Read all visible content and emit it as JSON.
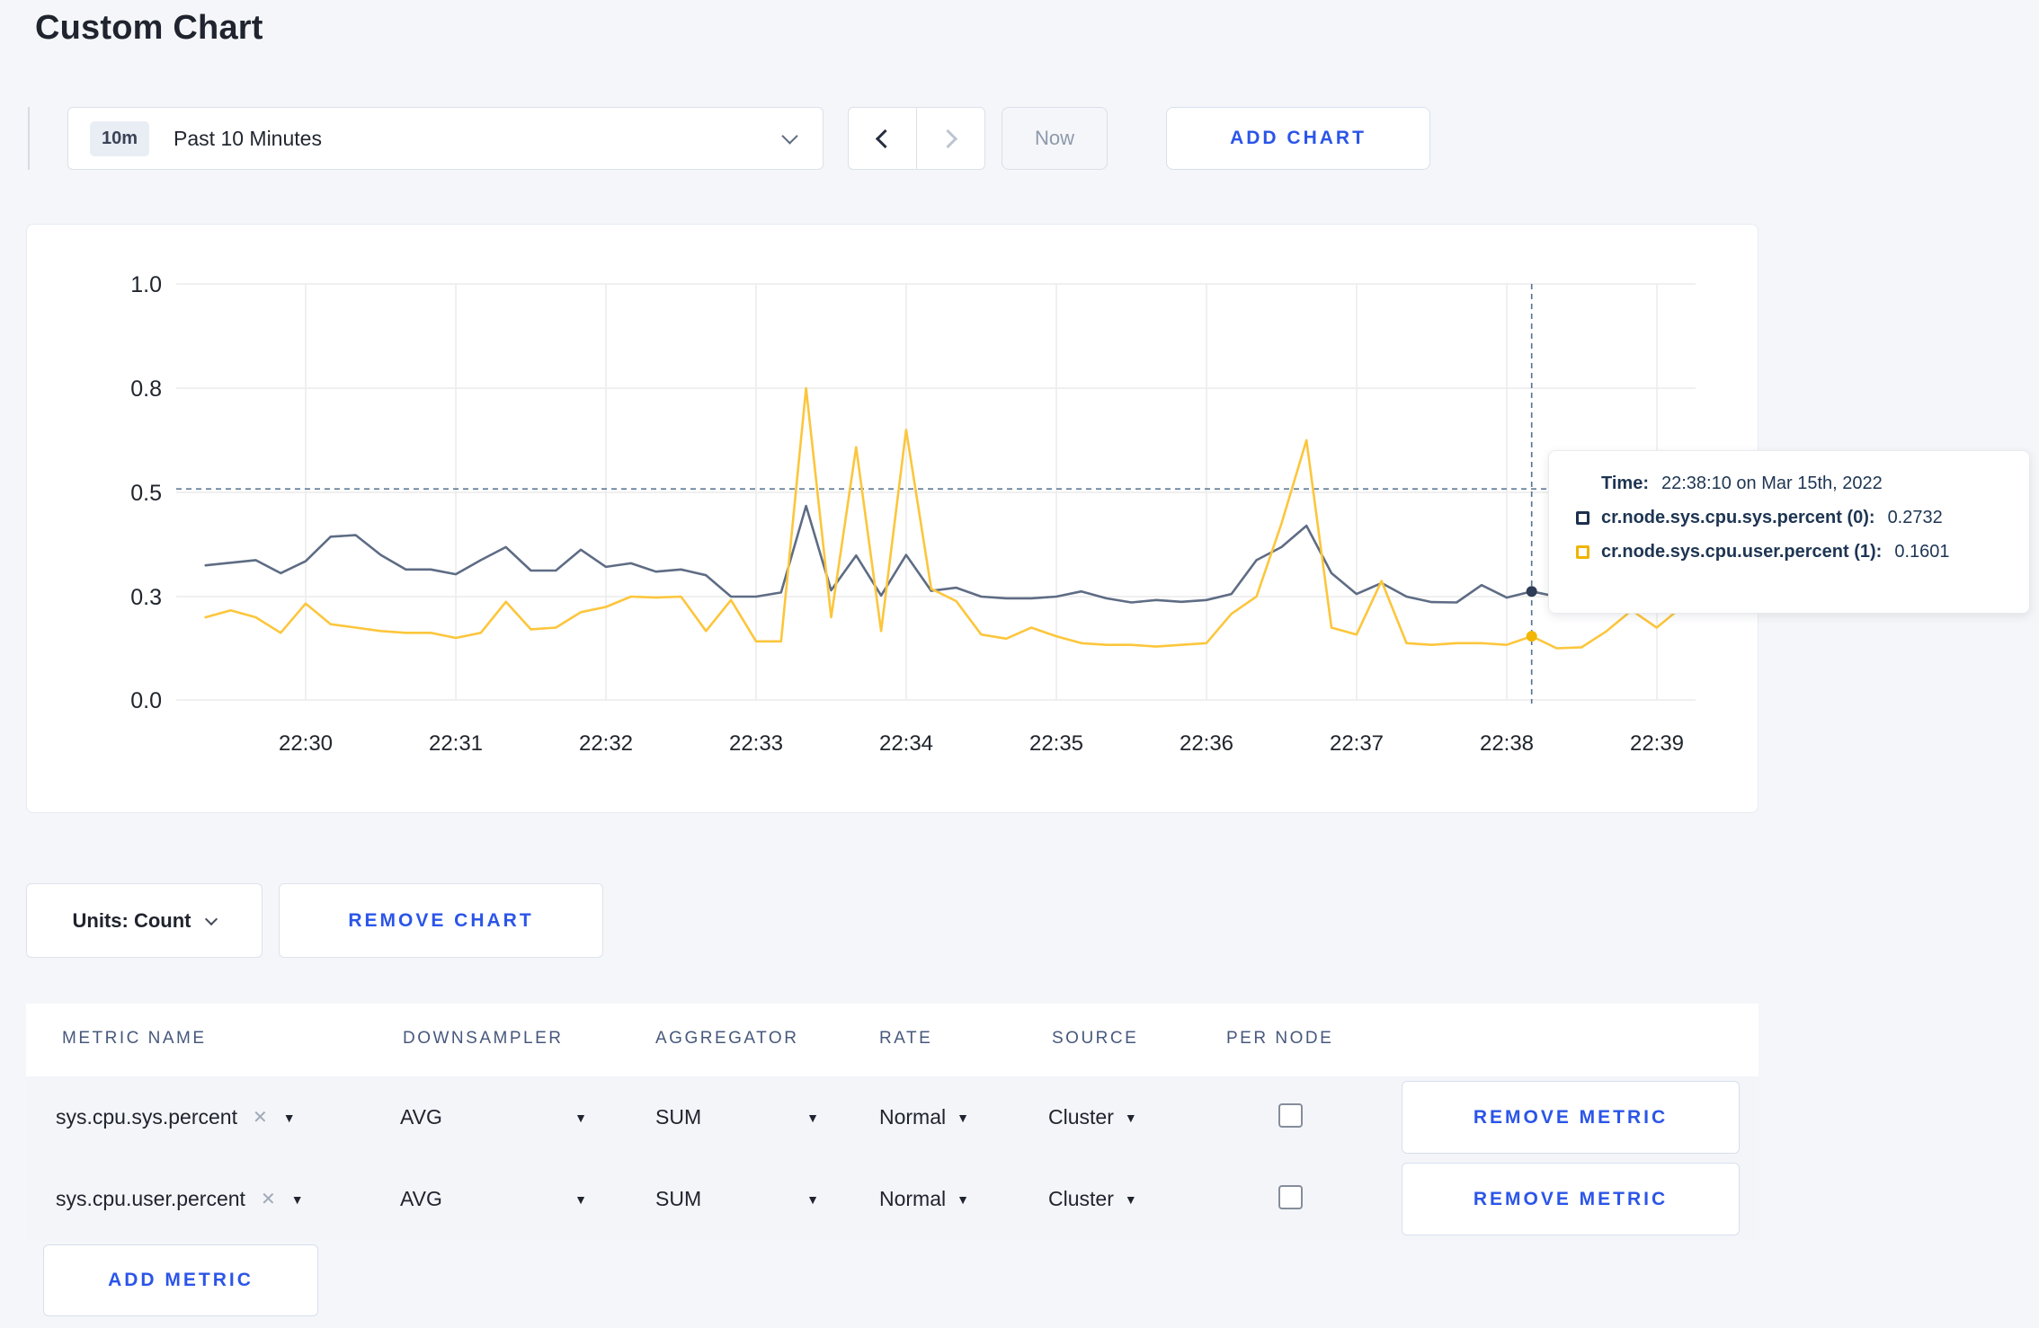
{
  "page": {
    "title": "Custom Chart",
    "background": "#f5f6f9",
    "accent_blue": "#2b55e8"
  },
  "icons": {
    "clear": "✕",
    "caret_down": "▼",
    "time_dropdown": "chevron-down-icon",
    "prev": "chevron-left-icon",
    "next": "chevron-right-icon"
  },
  "toolbar": {
    "time_range": {
      "badge": "10m",
      "label": "Past 10 Minutes"
    },
    "now_label": "Now",
    "add_chart_label": "ADD CHART"
  },
  "chart_data": {
    "type": "line",
    "title": "",
    "xlabel": "",
    "ylabel": "",
    "x_tick_labels": [
      "22:30",
      "22:31",
      "22:32",
      "22:33",
      "22:34",
      "22:35",
      "22:36",
      "22:37",
      "22:38",
      "22:39"
    ],
    "y_tick_labels": [
      0.0,
      0.3,
      0.5,
      0.8,
      1.0
    ],
    "ylim": [
      0,
      1.0
    ],
    "grid": true,
    "x_start_time": "22:29:20",
    "x_interval_seconds": 10,
    "series": [
      {
        "name": "cr.node.sys.cpu.sys.percent",
        "color": "#5e6c84",
        "dot_color": "#2e3c57",
        "values": [
          0.36,
          0.365,
          0.37,
          0.345,
          0.368,
          0.415,
          0.418,
          0.38,
          0.352,
          0.352,
          0.343,
          0.37,
          0.395,
          0.35,
          0.35,
          0.39,
          0.357,
          0.364,
          0.348,
          0.352,
          0.341,
          0.3,
          0.3,
          0.308,
          0.474,
          0.312,
          0.379,
          0.302,
          0.38,
          0.311,
          0.317,
          0.3,
          0.295,
          0.295,
          0.3,
          0.31,
          0.295,
          0.283,
          0.29,
          0.285,
          0.29,
          0.305,
          0.37,
          0.395,
          0.436,
          0.345,
          0.305,
          0.326,
          0.3,
          0.284,
          0.283,
          0.322,
          0.297,
          0.31,
          0.3,
          0.298,
          0.3,
          0.303,
          0.3,
          0.3
        ]
      },
      {
        "name": "cr.node.sys.cpu.user.percent",
        "color": "#fcc63c",
        "dot_color": "#f2b705",
        "values": [
          0.24,
          0.26,
          0.24,
          0.195,
          0.28,
          0.22,
          0.21,
          0.2,
          0.195,
          0.195,
          0.18,
          0.195,
          0.285,
          0.205,
          0.21,
          0.255,
          0.27,
          0.3,
          0.297,
          0.3,
          0.2,
          0.29,
          0.17,
          0.17,
          0.8,
          0.24,
          0.63,
          0.2,
          0.68,
          0.315,
          0.287,
          0.19,
          0.178,
          0.21,
          0.185,
          0.165,
          0.16,
          0.16,
          0.155,
          0.16,
          0.165,
          0.25,
          0.3,
          0.44,
          0.65,
          0.21,
          0.19,
          0.33,
          0.165,
          0.16,
          0.165,
          0.165,
          0.16,
          0.185,
          0.15,
          0.153,
          0.2,
          0.26,
          0.21,
          0.27
        ]
      }
    ],
    "crosshair": {
      "index": 53,
      "hover_value": 0.51,
      "time": "22:38:10"
    },
    "legend_position": "tooltip"
  },
  "tooltip": {
    "time_label": "Time:",
    "time_value": "22:38:10 on Mar 15th, 2022",
    "series": [
      {
        "label": "cr.node.sys.cpu.sys.percent (0):",
        "value": "0.2732",
        "color": "#1c2f4e"
      },
      {
        "label": "cr.node.sys.cpu.user.percent (1):",
        "value": "0.1601",
        "color": "#f0b400"
      }
    ]
  },
  "chart_actions": {
    "units_label": "Units: Count",
    "remove_chart_label": "REMOVE CHART"
  },
  "table": {
    "headers": [
      "METRIC NAME",
      "DOWNSAMPLER",
      "AGGREGATOR",
      "RATE",
      "SOURCE",
      "PER NODE"
    ],
    "remove_metric_label": "REMOVE METRIC",
    "add_metric_label": "ADD METRIC",
    "rows": [
      {
        "metric_name": "sys.cpu.sys.percent",
        "downsampler": "AVG",
        "aggregator": "SUM",
        "rate": "Normal",
        "source": "Cluster",
        "per_node_checked": false
      },
      {
        "metric_name": "sys.cpu.user.percent",
        "downsampler": "AVG",
        "aggregator": "SUM",
        "rate": "Normal",
        "source": "Cluster",
        "per_node_checked": false
      }
    ]
  }
}
